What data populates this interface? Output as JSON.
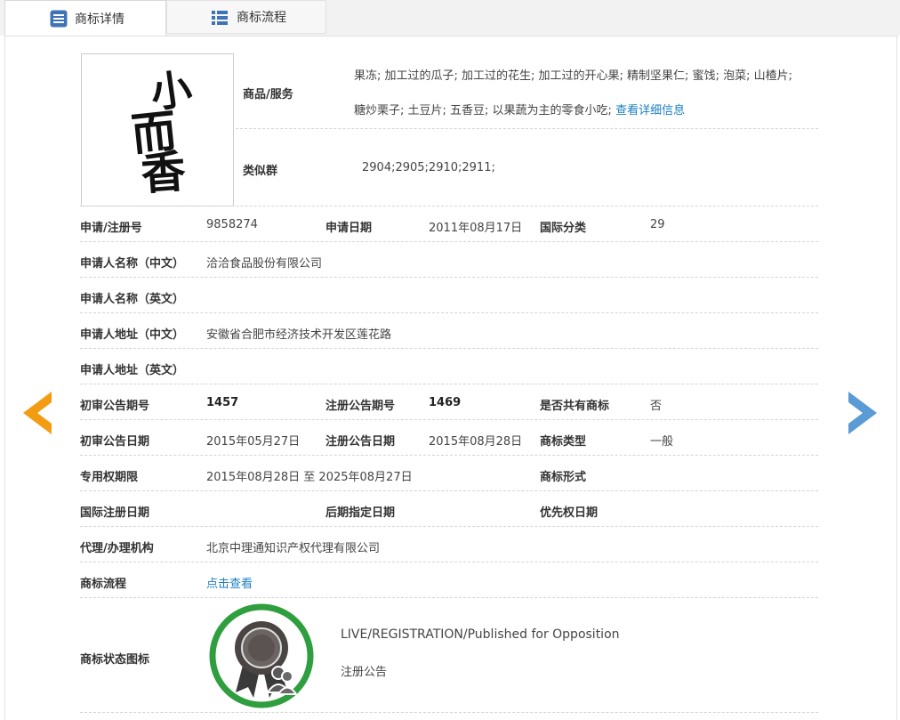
{
  "tabs": {
    "detail": "商标详情",
    "flow": "商标流程"
  },
  "trademark": {
    "logo_text": "小而香",
    "goods_label": "商品/服务",
    "goods_line1": "果冻; 加工过的瓜子; 加工过的花生; 加工过的开心果; 精制坚果仁; 蜜饯; 泡菜; 山楂片;",
    "goods_line2": "糖炒栗子; 土豆片; 五香豆; 以果蔬为主的零食小吃;",
    "goods_link": "查看详细信息",
    "similar_label": "类似群",
    "similar_value": "2904;2905;2910;2911;"
  },
  "fields": {
    "reg_no_label": "申请/注册号",
    "reg_no": "9858274",
    "apply_date_label": "申请日期",
    "apply_date": "2011年08月17日",
    "intl_class_label": "国际分类",
    "intl_class": "29",
    "applicant_cn_label": "申请人名称（中文）",
    "applicant_cn": "洽洽食品股份有限公司",
    "applicant_en_label": "申请人名称（英文）",
    "address_cn_label": "申请人地址（中文）",
    "address_cn": "安徽省合肥市经济技术开发区莲花路",
    "address_en_label": "申请人地址（英文）",
    "prelim_no_label": "初审公告期号",
    "prelim_no": "1457",
    "reg_pub_no_label": "注册公告期号",
    "reg_pub_no": "1469",
    "shared_label": "是否共有商标",
    "shared": "否",
    "prelim_date_label": "初审公告日期",
    "prelim_date": "2015年05月27日",
    "reg_pub_date_label": "注册公告日期",
    "reg_pub_date": "2015年08月28日",
    "tm_type_label": "商标类型",
    "tm_type": "一般",
    "exclusive_label": "专用权期限",
    "exclusive": "2015年08月28日 至 2025年08月27日",
    "tm_form_label": "商标形式",
    "intl_reg_date_label": "国际注册日期",
    "later_date_label": "后期指定日期",
    "priority_date_label": "优先权日期",
    "agent_label": "代理/办理机构",
    "agent": "北京中理通知识产权代理有限公司",
    "flow_label": "商标流程",
    "flow_link": "点击查看",
    "status_label": "商标状态图标",
    "status_en": "LIVE/REGISTRATION/Published for Opposition",
    "status_cn": "注册公告"
  },
  "colors": {
    "link": "#1a7fc1",
    "arrow_left": "#f39c12",
    "arrow_right": "#5b9bd5",
    "seal_ring": "#2e9e3e"
  }
}
